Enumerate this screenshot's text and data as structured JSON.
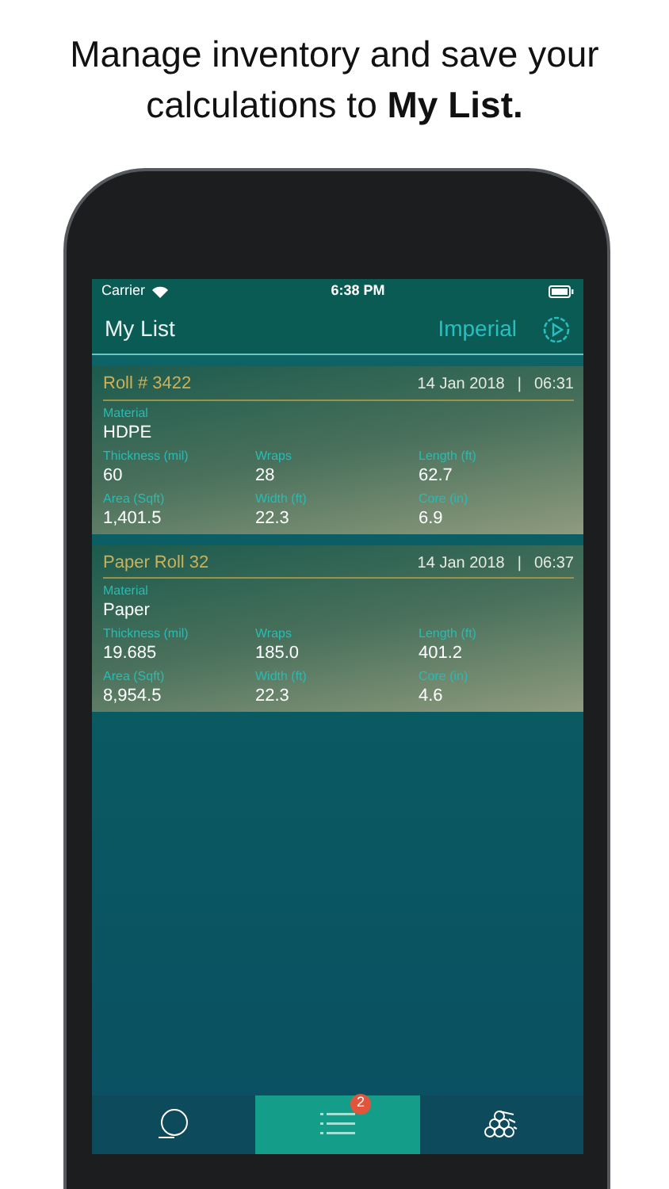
{
  "headline": "Manage inventory and save your calculations to **My List.**",
  "status_bar": {
    "carrier": "Carrier",
    "time": "6:38 PM"
  },
  "nav": {
    "title": "My List",
    "unit": "Imperial"
  },
  "items": [
    {
      "name": "Roll # 3422",
      "date": "14 Jan 2018",
      "separator": "|",
      "time": "06:31",
      "material": {
        "label": "Material",
        "value": "HDPE"
      },
      "fields": [
        {
          "label": "Thickness (mil)",
          "value": "60"
        },
        {
          "label": "Wraps",
          "value": "28"
        },
        {
          "label": "Length (ft)",
          "value": "62.7"
        },
        {
          "label": "Area (Sqft)",
          "value": "1,401.5"
        },
        {
          "label": "Width (ft)",
          "value": "22.3"
        },
        {
          "label": "Core (in)",
          "value": "6.9"
        }
      ]
    },
    {
      "name": "Paper Roll 32",
      "date": "14 Jan 2018",
      "separator": "|",
      "time": "06:37",
      "material": {
        "label": "Material",
        "value": "Paper"
      },
      "fields": [
        {
          "label": "Thickness (mil)",
          "value": "19.685"
        },
        {
          "label": "Wraps",
          "value": "185.0"
        },
        {
          "label": "Length (ft)",
          "value": "401.2"
        },
        {
          "label": "Area (Sqft)",
          "value": "8,954.5"
        },
        {
          "label": "Width (ft)",
          "value": "22.3"
        },
        {
          "label": "Core (in)",
          "value": "4.6"
        }
      ]
    }
  ],
  "tabs": [
    {
      "kind": "roll",
      "selected": false
    },
    {
      "kind": "list",
      "selected": true,
      "badge": "2"
    },
    {
      "kind": "stack",
      "selected": false
    }
  ]
}
